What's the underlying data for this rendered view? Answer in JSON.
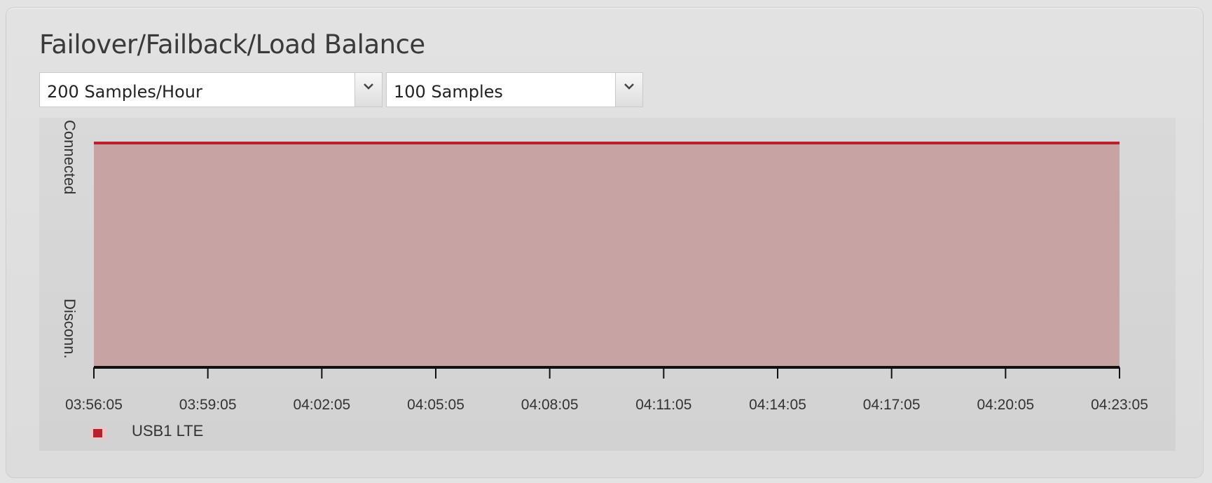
{
  "panel": {
    "title": "Failover/Failback/Load Balance"
  },
  "controls": {
    "sample_rate": {
      "selected": "200 Samples/Hour"
    },
    "sample_count": {
      "selected": "100 Samples"
    }
  },
  "colors": {
    "series_line": "#b8202c",
    "series_fill": "#c59a9a",
    "axis": "#111111"
  },
  "chart_data": {
    "type": "area",
    "ylabel_top": "Connected",
    "ylabel_bottom": "Disconn.",
    "x_ticks": [
      "03:56:05",
      "03:59:05",
      "04:02:05",
      "04:05:05",
      "04:08:05",
      "04:11:05",
      "04:14:05",
      "04:17:05",
      "04:20:05",
      "04:23:05"
    ],
    "series": [
      {
        "name": "USB1 LTE",
        "state": "Connected",
        "values": [
          1,
          1,
          1,
          1,
          1,
          1,
          1,
          1,
          1,
          1
        ]
      }
    ],
    "y_states": [
      "Disconn.",
      "Connected"
    ],
    "legend_position": "bottom-left"
  }
}
